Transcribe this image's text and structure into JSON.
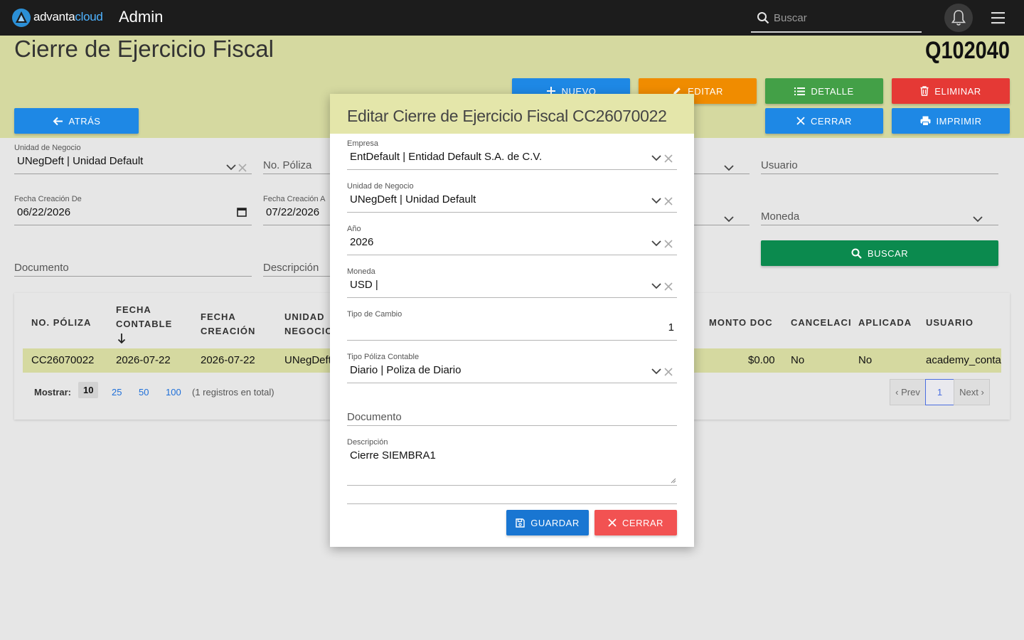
{
  "topbar": {
    "logo_text_main": "advanta",
    "logo_text_accent": "cloud",
    "app_title": "Admin",
    "search_placeholder": "Buscar"
  },
  "header": {
    "page_title": "Cierre de Ejercicio Fiscal",
    "record_code": "Q102040"
  },
  "actions": {
    "nuevo": "NUEVO",
    "editar": "EDITAR",
    "detalle": "DETALLE",
    "eliminar": "ELIMINAR",
    "atras": "ATRÁS",
    "cerrar": "CERRAR",
    "imprimir": "IMPRIMIR",
    "buscar": "BUSCAR"
  },
  "filters": {
    "unidad_negocio_label": "Unidad de Negocio",
    "unidad_negocio_value": "UNegDeft | Unidad Default",
    "no_poliza_placeholder": "No. Póliza",
    "usuario_placeholder": "Usuario",
    "fecha_de_label": "Fecha Creación De",
    "fecha_de_value": "06/22/2026",
    "fecha_a_label": "Fecha Creación A",
    "fecha_a_value": "07/22/2026",
    "moneda_placeholder": "Moneda",
    "documento_placeholder": "Documento",
    "descripcion_placeholder": "Descripción"
  },
  "table": {
    "headers": {
      "no_poliza": "NO. PÓLIZA",
      "fecha_contable_1": "FECHA",
      "fecha_contable_2": "CONTABLE",
      "fecha_creacion_1": "FECHA",
      "fecha_creacion_2": "CREACIÓN",
      "unidad_1": "UNIDAD",
      "unidad_2": "NEGOCIO",
      "monto_doc": "MONTO DOC",
      "cancelacion": "CANCELACIÓ",
      "aplicada": "APLICADA",
      "usuario": "USUARIO"
    },
    "row": {
      "no_poliza": "CC26070022",
      "fecha_contable": "2026-07-22",
      "fecha_creacion": "2026-07-22",
      "unidad": "UNegDeft",
      "monto_doc": "$0.00",
      "cancelacion": "No",
      "aplicada": "No",
      "usuario": "academy_conta"
    }
  },
  "pager": {
    "mostrar_label": "Mostrar:",
    "sizes": [
      "10",
      "25",
      "50",
      "100"
    ],
    "total": "(1 registros en total)",
    "prev": "‹ Prev",
    "current": "1",
    "next": "Next ›"
  },
  "modal": {
    "title": "Editar Cierre de Ejercicio Fiscal CC26070022",
    "empresa_label": "Empresa",
    "empresa_value": "EntDefault | Entidad Default S.A. de C.V.",
    "unidad_label": "Unidad de Negocio",
    "unidad_value": "UNegDeft | Unidad Default",
    "anio_label": "Año",
    "anio_value": "2026",
    "moneda_label": "Moneda",
    "moneda_value": "USD |",
    "tipo_cambio_label": "Tipo de Cambio",
    "tipo_cambio_value": "1",
    "tipo_poliza_label": "Tipo Póliza Contable",
    "tipo_poliza_value": "Diario | Poliza de Diario",
    "documento_placeholder": "Documento",
    "descripcion_label": "Descripción",
    "descripcion_value": "Cierre SIEMBRA1",
    "guardar": "GUARDAR",
    "cerrar": "CERRAR"
  },
  "colors": {
    "topbar": "#1c1c1c",
    "header_band": "#d5d9a0",
    "primary_blue": "#1e88e5",
    "orange": "#f08c00",
    "green": "#43a047",
    "red": "#e53935",
    "search_green": "#0b8a4e"
  }
}
